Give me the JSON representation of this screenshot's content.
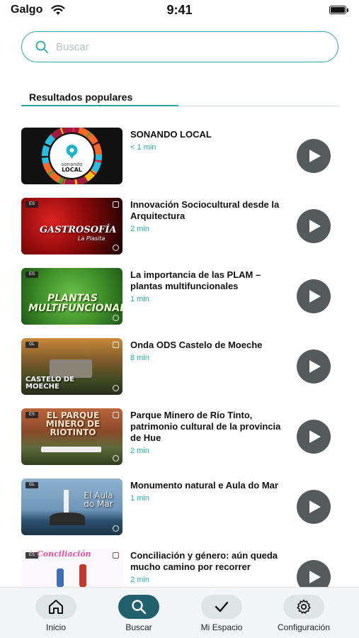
{
  "status_bar": {
    "carrier": "Galgo",
    "time": "9:41"
  },
  "search": {
    "placeholder": "Buscar",
    "value": ""
  },
  "section": {
    "title": "Resultados populares"
  },
  "colors": {
    "accent": "#2aa6a8",
    "active_tab": "#22606d",
    "play_button": "#555a5c"
  },
  "items": [
    {
      "title": "SONANDO LOCAL",
      "duration": "< 1 min",
      "thumb_icon": "sonando-local-logo"
    },
    {
      "title": "Innovación Sociocultural desde la Arquitectura",
      "duration": "2 min",
      "thumb_text": "GASTROSOFÍA",
      "thumb_sub": "La Plasita"
    },
    {
      "title": "La importancia de las PLAM – plantas multifuncionales",
      "duration": "1 min",
      "thumb_text": "PLANTAS MULTIFUNCIONALES"
    },
    {
      "title": "Onda ODS Castelo de Moeche",
      "duration": "8 min",
      "thumb_text": "CASTELO DE MOECHE"
    },
    {
      "title": "Parque Minero de Río Tinto, patrimonio cultural de la provincia de Hue",
      "duration": "2 min",
      "thumb_text": "EL PARQUE MINERO DE RIOTINTO"
    },
    {
      "title": "Monumento natural e Aula do Mar",
      "duration": "1 min",
      "thumb_text": "El Aula do Mar"
    },
    {
      "title": "Conciliación y género: aún queda mucho camino por recorrer",
      "duration": "2 min",
      "thumb_text": "Conciliación"
    }
  ],
  "tabs": [
    {
      "label": "Inicio",
      "icon": "home-icon",
      "active": false
    },
    {
      "label": "Buscar",
      "icon": "search-icon",
      "active": true
    },
    {
      "label": "Mi Espacio",
      "icon": "check-icon",
      "active": false
    },
    {
      "label": "Configuración",
      "icon": "gear-icon",
      "active": false
    }
  ]
}
